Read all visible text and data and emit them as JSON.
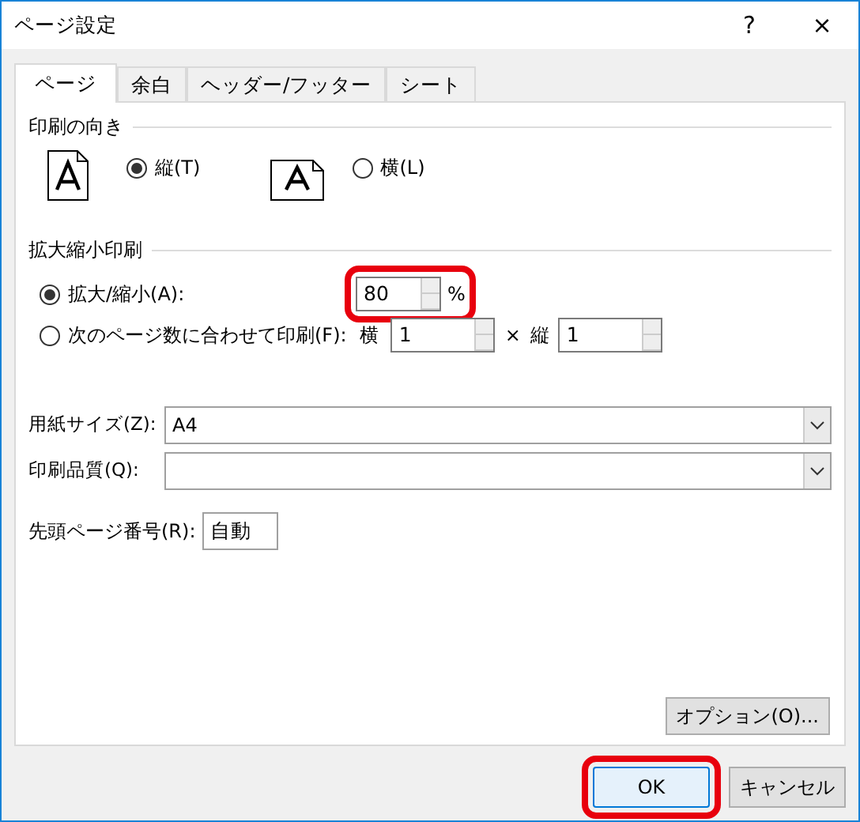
{
  "window": {
    "title": "ページ設定",
    "help": "?",
    "close": "×"
  },
  "tabs": [
    {
      "label": "ページ",
      "selected": true
    },
    {
      "label": "余白",
      "selected": false
    },
    {
      "label": "ヘッダー/フッター",
      "selected": false
    },
    {
      "label": "シート",
      "selected": false
    }
  ],
  "orientation": {
    "title": "印刷の向き",
    "options": [
      {
        "kind": "portrait",
        "label": "縦(T)",
        "selected": true
      },
      {
        "kind": "landscape",
        "label": "横(L)",
        "selected": false
      }
    ]
  },
  "scaling": {
    "title": "拡大縮小印刷",
    "options": [
      {
        "kind": "percent",
        "label": "拡大/縮小(A):",
        "selected": true,
        "value": "80",
        "unit": "%",
        "highlighted": true
      },
      {
        "kind": "fit",
        "label": "次のページ数に合わせて印刷(F):",
        "selected": false,
        "wide_label": "横",
        "wide_value": "1",
        "times": "×",
        "tall_label": "縦",
        "tall_value": "1"
      }
    ]
  },
  "paper_size": {
    "label": "用紙サイズ(Z):",
    "value": "A4"
  },
  "print_quality": {
    "label": "印刷品質(Q):"
  },
  "first_page_number": {
    "label": "先頭ページ番号(R):",
    "value": "自動"
  },
  "options_button": "オプション(O)...",
  "buttons": [
    {
      "label": "OK",
      "highlighted": true
    },
    {
      "label": "キャンセル",
      "highlighted": false
    }
  ]
}
